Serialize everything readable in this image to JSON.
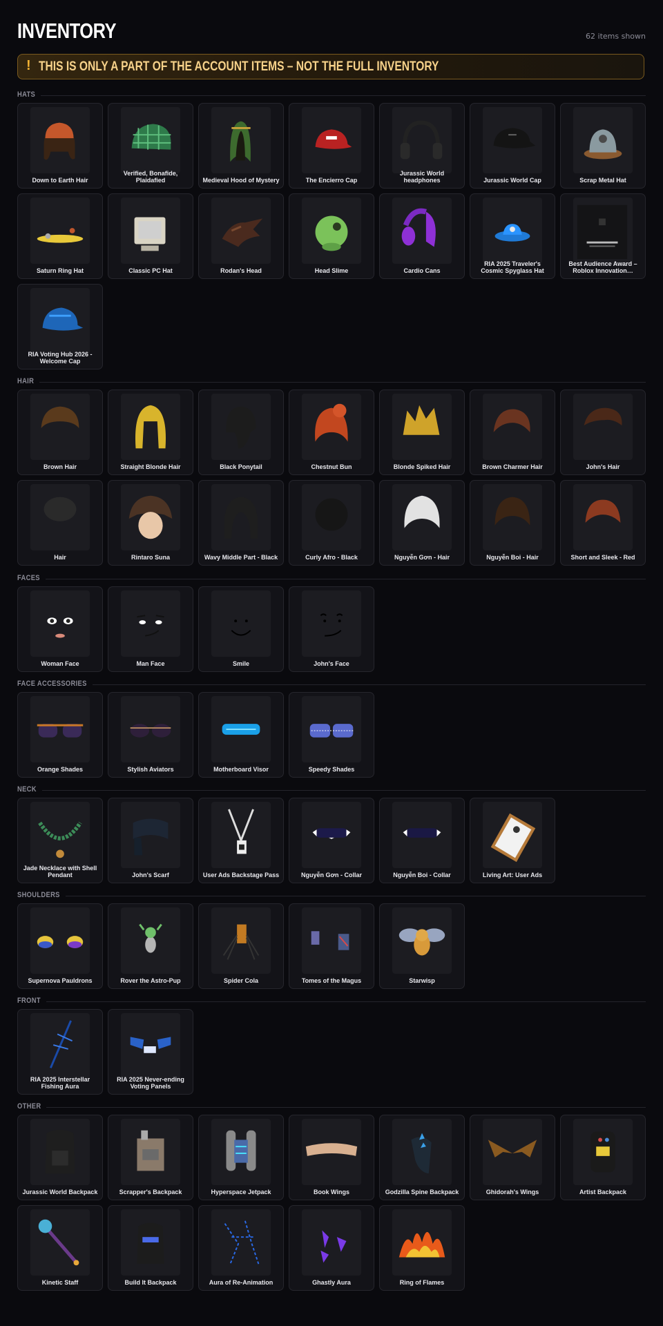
{
  "header": {
    "title": "INVENTORY",
    "count": "62 items shown"
  },
  "banner": {
    "icon": "exclamation-icon",
    "text": "THIS IS ONLY A PART OF THE ACCOUNT ITEMS – NOT THE FULL INVENTORY"
  },
  "colors": {
    "background": "#0a0a0e",
    "card": "#131318",
    "banner_border": "#7a5a1e",
    "banner_text": "#f7d28a",
    "accent": "#f2b233"
  },
  "sections": [
    {
      "label": "HATS",
      "items": [
        {
          "name": "Down to Earth Hair",
          "icon": "orange-beanie-hair"
        },
        {
          "name": "Verified, Bonafide, Plaidafied",
          "icon": "green-plaid-cap"
        },
        {
          "name": "Medieval Hood of Mystery",
          "icon": "green-hood"
        },
        {
          "name": "The Encierro Cap",
          "icon": "red-cap"
        },
        {
          "name": "Jurassic World headphones",
          "icon": "headphones"
        },
        {
          "name": "Jurassic World Cap",
          "icon": "black-cap"
        },
        {
          "name": "Scrap Metal Hat",
          "icon": "scrap-hat"
        },
        {
          "name": "Saturn Ring Hat",
          "icon": "saturn-ring"
        },
        {
          "name": "Classic PC Hat",
          "icon": "pc-monitor"
        },
        {
          "name": "Rodan's Head",
          "icon": "rodan-head"
        },
        {
          "name": "Head Slime",
          "icon": "green-slime"
        },
        {
          "name": "Cardio Cans",
          "icon": "purple-headphones"
        },
        {
          "name": "RIA 2025 Traveler's Cosmic Spyglass Hat",
          "icon": "blue-hat"
        },
        {
          "name": "Best Audience Award – Roblox Innovation…",
          "icon": "award-plaque"
        },
        {
          "name": "RIA Voting Hub 2026 - Welcome Cap",
          "icon": "blue-cap"
        }
      ]
    },
    {
      "label": "HAIR",
      "items": [
        {
          "name": "Brown Hair",
          "icon": "brown-hair"
        },
        {
          "name": "Straight Blonde Hair",
          "icon": "blonde-hair"
        },
        {
          "name": "Black Ponytail",
          "icon": "black-ponytail"
        },
        {
          "name": "Chestnut Bun",
          "icon": "red-bun"
        },
        {
          "name": "Blonde Spiked Hair",
          "icon": "blonde-spikes"
        },
        {
          "name": "Brown Charmer Hair",
          "icon": "brown-charmer"
        },
        {
          "name": "John's Hair",
          "icon": "johns-hair"
        },
        {
          "name": "Hair",
          "icon": "dark-hair"
        },
        {
          "name": "Rintaro Suna",
          "icon": "rintaro-head"
        },
        {
          "name": "Wavy Middle Part - Black",
          "icon": "wavy-black"
        },
        {
          "name": "Curly Afro - Black",
          "icon": "afro-black"
        },
        {
          "name": "Nguyễn Gơn - Hair",
          "icon": "white-hair"
        },
        {
          "name": "Nguyễn Boi - Hair",
          "icon": "brown-hair-2"
        },
        {
          "name": "Short and Sleek - Red",
          "icon": "red-short"
        }
      ]
    },
    {
      "label": "FACES",
      "items": [
        {
          "name": "Woman Face",
          "icon": "woman-face"
        },
        {
          "name": "Man Face",
          "icon": "man-face"
        },
        {
          "name": "Smile",
          "icon": "smile-face"
        },
        {
          "name": "John's Face",
          "icon": "johns-face"
        }
      ]
    },
    {
      "label": "FACE ACCESSORIES",
      "items": [
        {
          "name": "Orange Shades",
          "icon": "orange-shades"
        },
        {
          "name": "Stylish Aviators",
          "icon": "aviators"
        },
        {
          "name": "Motherboard Visor",
          "icon": "visor"
        },
        {
          "name": "Speedy Shades",
          "icon": "speedy-shades"
        }
      ]
    },
    {
      "label": "NECK",
      "items": [
        {
          "name": "Jade Necklace with Shell Pendant",
          "icon": "jade-necklace"
        },
        {
          "name": "John's Scarf",
          "icon": "scarf"
        },
        {
          "name": "User Ads Backstage Pass",
          "icon": "lanyard"
        },
        {
          "name": "Nguyễn Gơn - Collar",
          "icon": "spiked-collar"
        },
        {
          "name": "Nguyễn Boi - Collar",
          "icon": "spiked-collar-2"
        },
        {
          "name": "Living Art: User Ads",
          "icon": "picture-frame"
        }
      ]
    },
    {
      "label": "SHOULDERS",
      "items": [
        {
          "name": "Supernova Pauldrons",
          "icon": "pauldrons"
        },
        {
          "name": "Rover the Astro-Pup",
          "icon": "astro-pup"
        },
        {
          "name": "Spider Cola",
          "icon": "spider-cola"
        },
        {
          "name": "Tomes of the Magus",
          "icon": "tomes"
        },
        {
          "name": "Starwisp",
          "icon": "starwisp"
        }
      ]
    },
    {
      "label": "FRONT",
      "items": [
        {
          "name": "RIA 2025 Interstellar Fishing Aura",
          "icon": "fishing-aura"
        },
        {
          "name": "RIA 2025 Never-ending Voting Panels",
          "icon": "voting-panels"
        }
      ]
    },
    {
      "label": "OTHER",
      "items": [
        {
          "name": "Jurassic World Backpack",
          "icon": "black-backpack"
        },
        {
          "name": "Scrapper's Backpack",
          "icon": "scrapper-backpack"
        },
        {
          "name": "Hyperspace Jetpack",
          "icon": "jetpack"
        },
        {
          "name": "Book Wings",
          "icon": "book-wings"
        },
        {
          "name": "Godzilla Spine Backpack",
          "icon": "godzilla-backpack"
        },
        {
          "name": "Ghidorah's Wings",
          "icon": "ghidorah-wings"
        },
        {
          "name": "Artist Backpack",
          "icon": "artist-backpack"
        },
        {
          "name": "Kinetic Staff",
          "icon": "staff"
        },
        {
          "name": "Build It Backpack",
          "icon": "build-backpack"
        },
        {
          "name": "Aura of Re-Animation",
          "icon": "blue-aura"
        },
        {
          "name": "Ghastly Aura",
          "icon": "purple-aura"
        },
        {
          "name": "Ring of Flames",
          "icon": "flames"
        }
      ]
    }
  ]
}
